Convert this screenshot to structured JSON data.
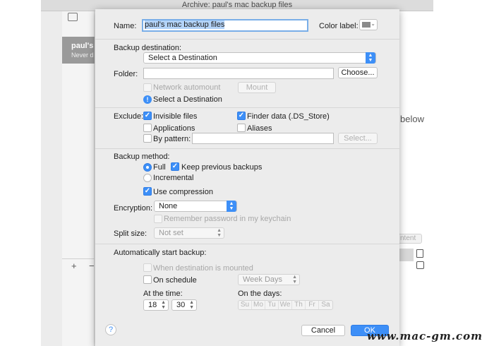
{
  "window": {
    "title": "Archive: paul's mac backup files"
  },
  "background": {
    "sidebar_selected_title": "paul's m",
    "sidebar_selected_subtitle": "Never d",
    "plus_label": "+",
    "minus_label": "−",
    "right_text": "below",
    "right_button": "ntent"
  },
  "sheet": {
    "name_label": "Name:",
    "name_value": "paul's mac backup files",
    "color_label": "Color label:",
    "backup_destination_label": "Backup destination:",
    "destination_popup": "Select a Destination",
    "folder_label": "Folder:",
    "folder_value": "",
    "choose_button": "Choose...",
    "network_automount": "Network automount",
    "mount_button": "Mount",
    "info_icon_glyph": "!",
    "destination_warning": "Select a Destination",
    "exclude_label": "Exclude:",
    "invisible_files": "Invisible files",
    "finder_data": "Finder data (.DS_Store)",
    "applications": "Applications",
    "aliases": "Aliases",
    "by_pattern": "By pattern:",
    "pattern_value": "",
    "select_button": "Select...",
    "backup_method_label": "Backup method:",
    "full": "Full",
    "keep_previous": "Keep previous backups",
    "incremental": "Incremental",
    "use_compression": "Use compression",
    "encryption_label": "Encryption:",
    "encryption_value": "None",
    "remember_password": "Remember password in my keychain",
    "split_size_label": "Split size:",
    "split_size_value": "Not set",
    "auto_start_label": "Automatically start backup:",
    "when_mounted": "When destination is mounted",
    "on_schedule": "On schedule",
    "schedule_value": "Week Days",
    "at_time_label": "At the time:",
    "hour_value": "18",
    "minute_value": "30",
    "on_days_label": "On the days:",
    "days": [
      "Su",
      "Mo",
      "Tu",
      "We",
      "Th",
      "Fr",
      "Sa"
    ],
    "help_glyph": "?",
    "cancel_button": "Cancel",
    "ok_button": "OK"
  },
  "watermark": "www.mac-gm.com",
  "colors": {
    "accent": "#3d8ff7",
    "sheet_bg": "#ececec",
    "label_swatch": "#8a8a8a"
  }
}
